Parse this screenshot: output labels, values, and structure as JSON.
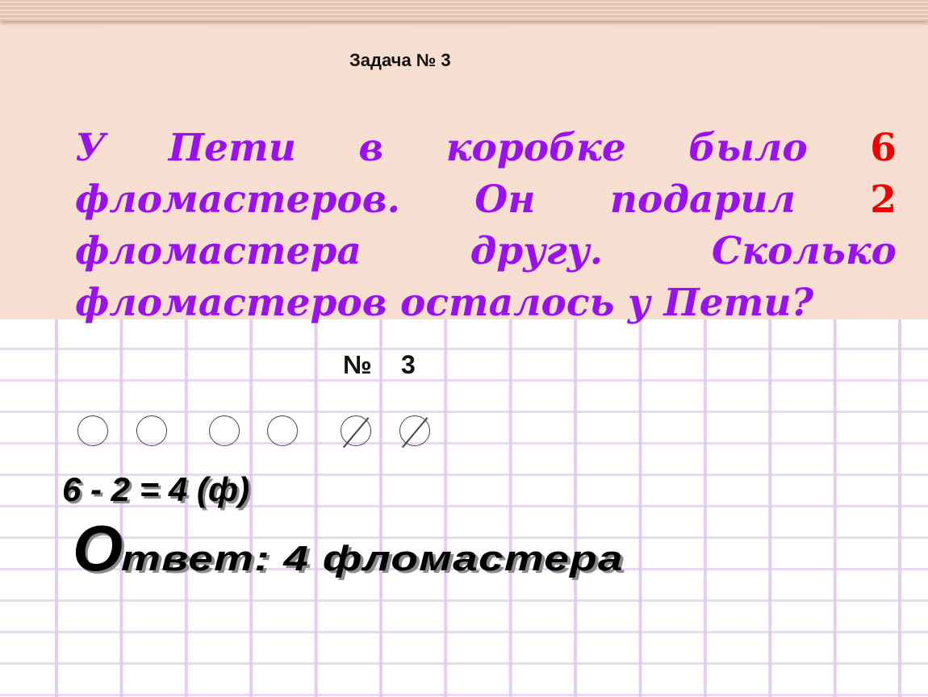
{
  "slide": {
    "title": "Задача № 3",
    "problem": {
      "parts": [
        {
          "text": "У Пети в коробке было ",
          "highlight": false
        },
        {
          "text": "6",
          "highlight": true
        },
        {
          "text": " фломастеров. Он подарил ",
          "highlight": false
        },
        {
          "text": "2",
          "highlight": true
        },
        {
          "text": " фломастера другу. Сколько фломастеров осталось у Пети?",
          "highlight": false
        }
      ]
    },
    "notebook": {
      "number_sign": "№",
      "number_value": "3",
      "circles": [
        {
          "state": "plain"
        },
        {
          "state": "plain"
        },
        {
          "state": "plain"
        },
        {
          "state": "plain"
        },
        {
          "state": "crossed"
        },
        {
          "state": "crossed"
        }
      ],
      "equation": "6 - 2 = 4 (ф)",
      "answer_initial": "О",
      "answer_rest": "твет: 4 фломастера"
    },
    "colors": {
      "problem_text": "#9a10f5",
      "highlight_number": "#f00000",
      "panel_background": "#f8dfd0",
      "grid_line": "#e8d4f0"
    }
  }
}
